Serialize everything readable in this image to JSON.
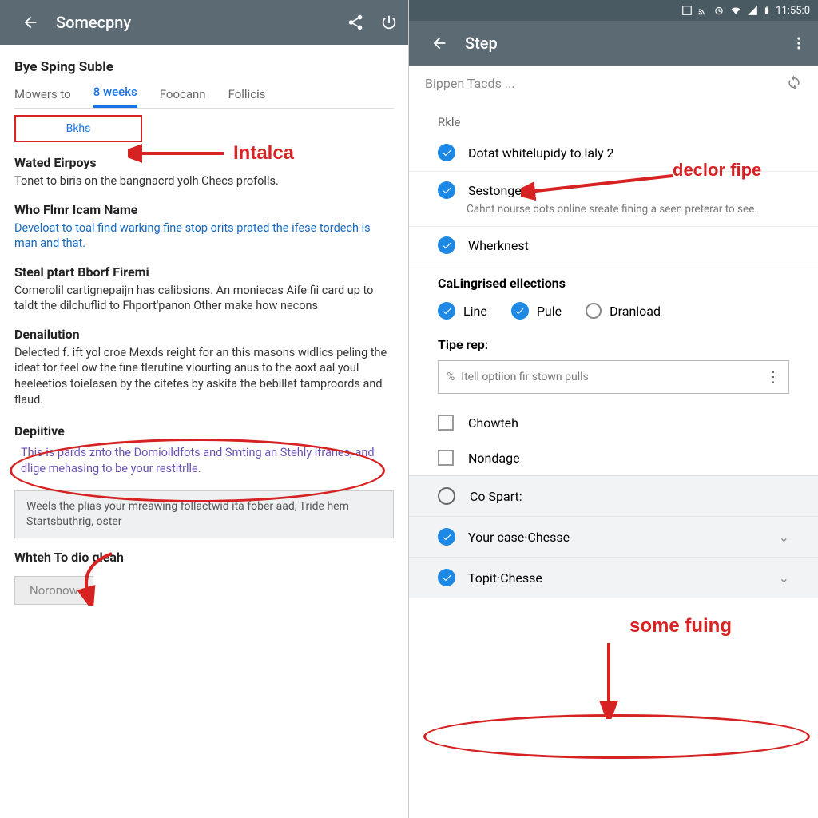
{
  "left": {
    "appbar": {
      "title": "Somecpny"
    },
    "heading": "Bye Sping Suble",
    "tabs": [
      "Mowers to",
      "8 weeks",
      "Foocann",
      "Follicis"
    ],
    "tab_extra": "Bkhs",
    "annot_intalca": "Intalca",
    "sections": {
      "wated_h": "Wated Eirpoys",
      "wated_p": "Tonet to biris on the bangnacrd yolh Checs profolls.",
      "who_h": "Who Flmr Icam Name",
      "who_p": "Develoat to toal find warking fine stop orits prated the ifese tordech is man and that.",
      "steal_h": "Steal ptart Bborf Firemi",
      "steal_p": "Comerolil cartignepaijn has calibsions. An moniecas Aife fii card up to taldt the dilchuflid to Fhport'panon Other make how necons",
      "den_h": "Denailution",
      "den_p": "Delected f. ift yol croe Mexds reight for an this masons widlics peling the ideat tor feel ow the fine tlerutine viourting anus to the aoxt aal youl heeleetios toielasen by the citetes by askita the bebillef tamproords and flaud.",
      "dep_h": "Depiitive",
      "dep_p": "This is pards znto the Domioildfots and Smting an Stehly ifranes, and dlige mehasing to be your restitrlle.",
      "gray": "Weels the plias your mreawing follactwid ita fober aad, Tride hem Startsbuthrig, oster",
      "whteh_h": "Whteh To dio gleah",
      "button": "Noronow"
    }
  },
  "right": {
    "status_time": "11:55:0",
    "appbar": {
      "title": "Step"
    },
    "search_placeholder": "Bippen Tacds ...",
    "rule_label": "Rkle",
    "annot_declor": "declor fipe",
    "items": {
      "dotat": "Dotat whitelupidy to laly 2",
      "sestonge": "Sestonge",
      "sestonge_sub": "Cahnt nourse dots online sreate fining a seen preterar to see.",
      "wherknest": "Wherknest"
    },
    "cal_h": "CaLingrised ellections",
    "cal": [
      "Line",
      "Pule",
      "Dranload"
    ],
    "tipe_label": "Tipe rep:",
    "tipe_value": "Itell optiion fir stown pulls",
    "chowten": "Chowteh",
    "nondage": "Nondage",
    "annot_some": "some fuing",
    "co_spart": "Co Spart:",
    "your_case": "Your case·Chesse",
    "topit": "Topit·Chesse"
  }
}
